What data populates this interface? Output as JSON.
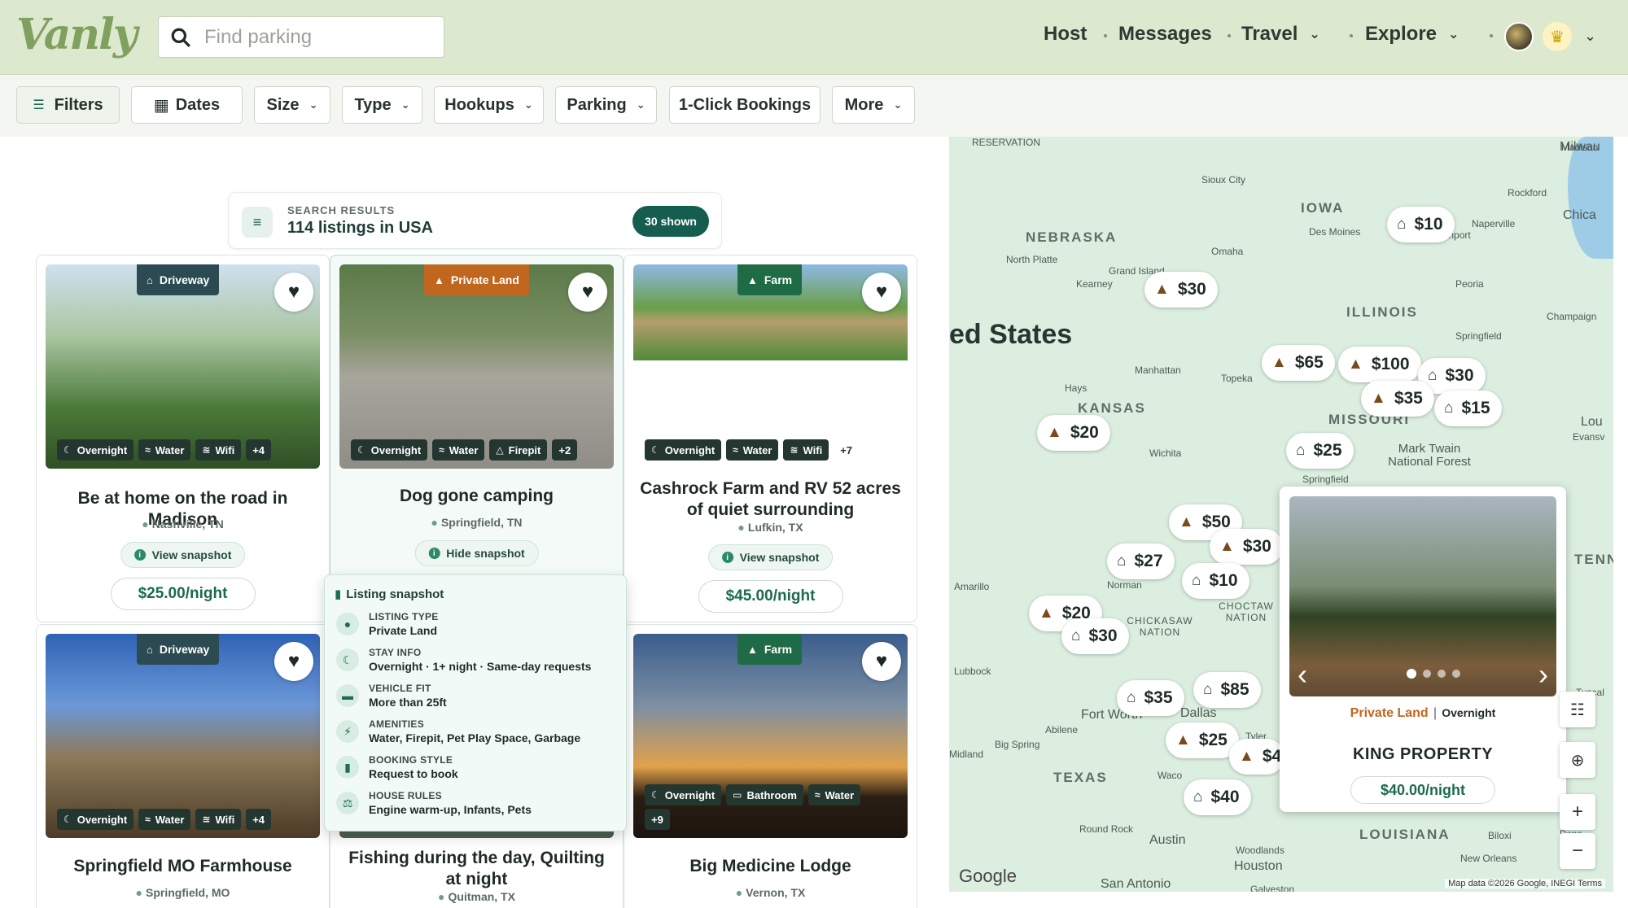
{
  "header": {
    "logo": "Vanly",
    "search_placeholder": "Find parking",
    "nav": {
      "host": "Host",
      "messages": "Messages",
      "travel": "Travel",
      "explore": "Explore"
    }
  },
  "filters": [
    "Filters",
    "Dates",
    "Size",
    "Type",
    "Hookups",
    "Parking",
    "1-Click Bookings",
    "More"
  ],
  "results": {
    "label": "SEARCH RESULTS",
    "count": "114 listings in USA",
    "shown": "30 shown"
  },
  "listings": [
    {
      "badge": "Driveway",
      "amenities": [
        "Overnight",
        "Water",
        "Wifi",
        "+4"
      ],
      "title": "Be at home on the road in Madison",
      "location": "Nashville, TN",
      "snapshot": "View snapshot",
      "price": "$25.00/night"
    },
    {
      "badge": "Private Land",
      "amenities": [
        "Overnight",
        "Water",
        "Firepit",
        "+2"
      ],
      "title": "Dog gone camping",
      "location": "Springfield, TN",
      "snapshot": "Hide snapshot"
    },
    {
      "badge": "Farm",
      "amenities": [
        "Overnight",
        "Water",
        "Wifi",
        "+7"
      ],
      "title": "Cashrock Farm and RV 52 acres of quiet surrounding",
      "location": "Lufkin, TX",
      "snapshot": "View snapshot",
      "price": "$45.00/night"
    },
    {
      "badge": "Driveway",
      "amenities": [
        "Overnight",
        "Water",
        "Wifi",
        "+4"
      ],
      "title": "Springfield MO Farmhouse",
      "location": "Springfield, MO"
    },
    {
      "title": "Fishing during the day, Quilting at night",
      "location": "Quitman, TX"
    },
    {
      "badge": "Farm",
      "amenities": [
        "Overnight",
        "Bathroom",
        "Water",
        "+9"
      ],
      "title": "Big Medicine Lodge",
      "location": "Vernon, TX"
    }
  ],
  "snapshot": {
    "title": "Listing snapshot",
    "rows": [
      {
        "key": "LISTING TYPE",
        "value": "Private Land"
      },
      {
        "key": "STAY INFO",
        "value": "Overnight · 1+ night · Same-day requests"
      },
      {
        "key": "VEHICLE FIT",
        "value": "More than 25ft"
      },
      {
        "key": "AMENITIES",
        "value": "Water, Firepit, Pet Play Space, Garbage"
      },
      {
        "key": "BOOKING STYLE",
        "value": "Request to book"
      },
      {
        "key": "HOUSE RULES",
        "value": "Engine warm-up, Infants, Pets"
      }
    ]
  },
  "map": {
    "big_label": "ed States",
    "states": [
      "NEBRASKA",
      "IOWA",
      "ILLINOIS",
      "KANSAS",
      "MISSOURI",
      "TEXAS",
      "LOUISIANA",
      "TENN"
    ],
    "cities": [
      "Madison",
      "Milwau",
      "Sioux City",
      "Rockford",
      "Chica",
      "Des Moines",
      "Naperville",
      "avenport",
      "North Platte",
      "Omaha",
      "Grand Island",
      "Kearney",
      "Peoria",
      "Champaign",
      "Springfield",
      "Manhattan",
      "Topeka",
      "Hays",
      "Wichita",
      "Lou",
      "Evansv",
      "Mark Twain National Forest",
      "Springfield",
      "Amarillo",
      "Norman",
      "CHICKASAW NATION",
      "CHOCTAW NATION",
      "Lubbock",
      "Fort Worth",
      "Dallas",
      "Abilene",
      "Tyler",
      "Big Spring",
      "Midland",
      "Waco",
      "Round Rock",
      "Austin",
      "Houston",
      "San Antonio",
      "Woodlands",
      "Galveston",
      "Biloxi",
      "Pens",
      "New Orleans",
      "Tuscal",
      "RESERVATION"
    ],
    "pins": [
      {
        "label": "$10",
        "kind": "house"
      },
      {
        "label": "$30",
        "kind": "land"
      },
      {
        "label": "$65",
        "kind": "land"
      },
      {
        "label": "$100",
        "kind": "land"
      },
      {
        "label": "$30",
        "kind": "house"
      },
      {
        "label": "$35",
        "kind": "land"
      },
      {
        "label": "$15",
        "kind": "house"
      },
      {
        "label": "$20",
        "kind": "land"
      },
      {
        "label": "$25",
        "kind": "house"
      },
      {
        "label": "$50",
        "kind": "land"
      },
      {
        "label": "$30",
        "kind": "land"
      },
      {
        "label": "$27",
        "kind": "house"
      },
      {
        "label": "$10",
        "kind": "house"
      },
      {
        "label": "$20",
        "kind": "land"
      },
      {
        "label": "$30",
        "kind": "house"
      },
      {
        "label": "$35",
        "kind": "house"
      },
      {
        "label": "$85",
        "kind": "house"
      },
      {
        "label": "$25",
        "kind": "land"
      },
      {
        "label": "$4",
        "kind": "land"
      },
      {
        "label": "$40",
        "kind": "house"
      }
    ],
    "card": {
      "type": "Private Land",
      "stay": "Overnight",
      "name": "KING PROPERTY",
      "price": "$40.00/night"
    },
    "google": "Google",
    "footer": "Map data ©2026 Google, INEGI   Terms"
  }
}
